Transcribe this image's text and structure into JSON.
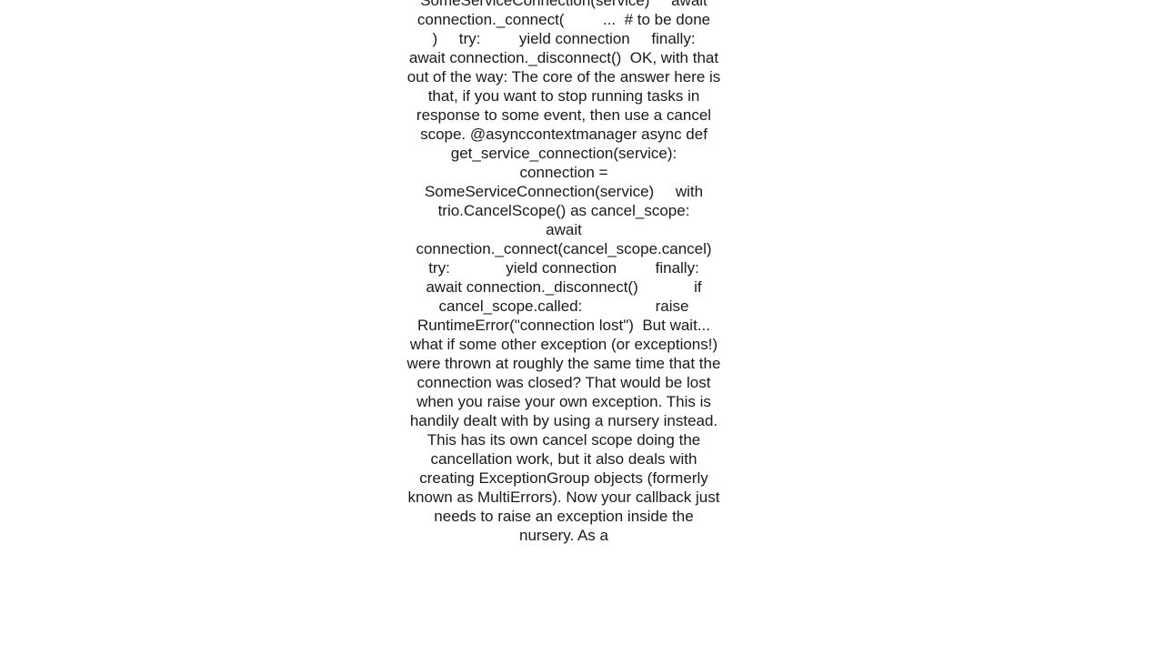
{
  "content": {
    "text": "SomeServiceConnection(service)     await connection._connect(         ...  # to be done     )     try:         yield connection     finally:         await connection._disconnect()  OK, with that out of the way: The core of the answer here is that, if you want to stop running tasks in response to some event, then use a cancel scope. @asynccontextmanager async def get_service_connection(service):     connection = SomeServiceConnection(service)     with trio.CancelScope() as cancel_scope:         await connection._connect(cancel_scope.cancel)         try:             yield connection         finally:             await connection._disconnect()             if cancel_scope.called:                 raise RuntimeError(\"connection lost\")  But wait... what if some other exception (or exceptions!) were thrown at roughly the same time that the connection was closed? That would be lost when you raise your own exception. This is handily dealt with by using a nursery instead. This has its own cancel scope doing the cancellation work, but it also deals with creating ExceptionGroup objects (formerly known as MultiErrors). Now your callback just needs to raise an exception inside the nursery. As a"
  }
}
